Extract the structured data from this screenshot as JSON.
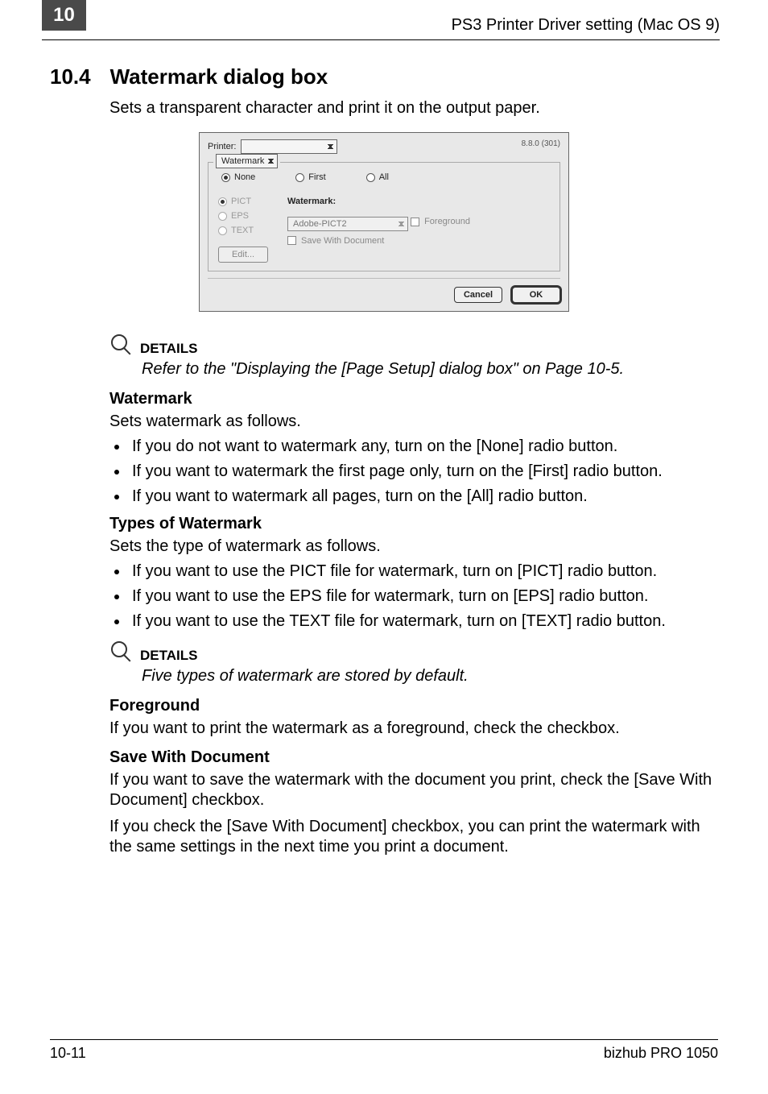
{
  "header": {
    "chapter": "10",
    "right": "PS3 Printer Driver setting (Mac OS 9)"
  },
  "section": {
    "number": "10.4",
    "title": "Watermark dialog box",
    "subtitle": "Sets a transparent character and print it on the output paper."
  },
  "dialog": {
    "printer_label": "Printer:",
    "version": "8.8.0 (301)",
    "panel_name": "Watermark",
    "modes": {
      "none": "None",
      "first": "First",
      "all": "All"
    },
    "types": {
      "pict": "PICT",
      "eps": "EPS",
      "text": "TEXT"
    },
    "wm_label": "Watermark:",
    "wm_value": "Adobe-PICT2",
    "foreground": "Foreground",
    "save_with_doc": "Save With Document",
    "edit": "Edit...",
    "cancel": "Cancel",
    "ok": "OK"
  },
  "details1": {
    "label": "DETAILS",
    "text": "Refer to the \"Displaying the [Page Setup] dialog box\" on Page 10-5."
  },
  "watermark_section": {
    "heading": "Watermark",
    "intro": "Sets watermark as follows.",
    "b1": "If you do not want to watermark any, turn on the [None] radio button.",
    "b2": "If you want to watermark the first page only, turn on the [First] radio button.",
    "b3": "If you want to watermark all pages, turn on the [All] radio button."
  },
  "types_section": {
    "heading": "Types of Watermark",
    "intro": "Sets the type of watermark as follows.",
    "b1": "If you want to use the PICT file for watermark, turn on [PICT] radio button.",
    "b2": "If you want to use the EPS file for watermark, turn on [EPS] radio button.",
    "b3": "If you want to use the TEXT file for watermark, turn on [TEXT] radio button."
  },
  "details2": {
    "label": "DETAILS",
    "text": "Five types of watermark are stored by default."
  },
  "foreground_section": {
    "heading": "Foreground",
    "text": "If you want to print the watermark as a foreground, check the checkbox."
  },
  "save_section": {
    "heading": "Save With Document",
    "p1": "If you want to save the watermark with the document you print, check the [Save With Document] checkbox.",
    "p2": "If you check the [Save With Document] checkbox, you can print the watermark with the same settings in the next time you print a document."
  },
  "footer": {
    "left": "10-11",
    "right": "bizhub PRO 1050"
  }
}
